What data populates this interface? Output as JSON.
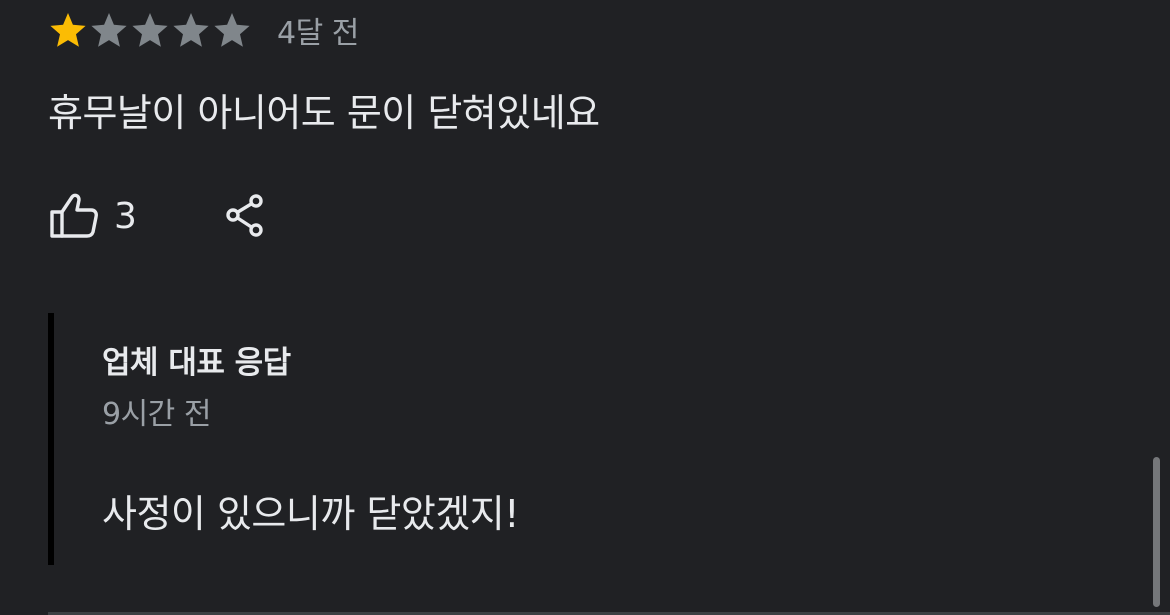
{
  "review": {
    "rating": 1,
    "max_rating": 5,
    "time": "4달 전",
    "text": "휴무날이 아니어도 문이 닫혀있네요",
    "like_count": "3"
  },
  "owner_response": {
    "title": "업체 대표 응답",
    "time": "9시간 전",
    "text": "사정이 있으니까 닫았겠지!"
  },
  "colors": {
    "background": "#202124",
    "star_filled": "#fbbc04",
    "star_empty": "#80868b",
    "text_primary": "#e8eaed",
    "text_secondary": "#9aa0a6",
    "reply_border": "#000000"
  },
  "icons": {
    "like": "thumbs-up-outline-icon",
    "share": "share-icon",
    "star": "star-icon"
  }
}
